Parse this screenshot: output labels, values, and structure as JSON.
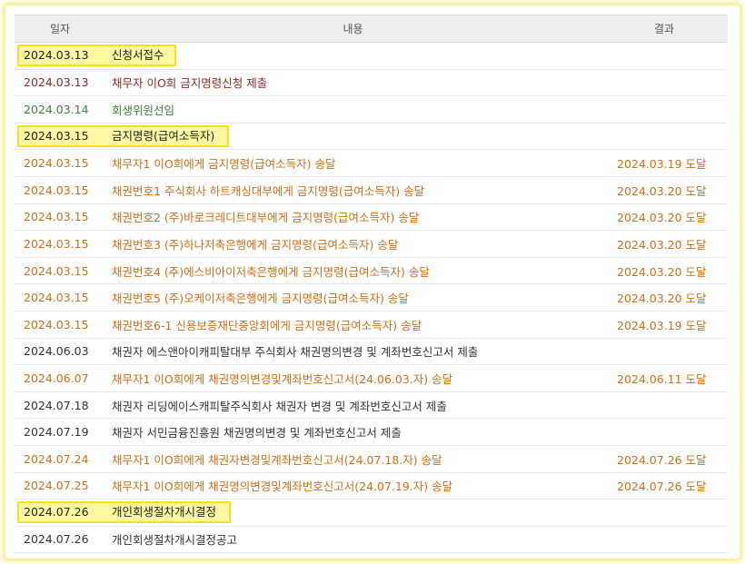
{
  "header": {
    "date": "일자",
    "content": "내용",
    "result": "결과"
  },
  "rows": [
    {
      "date": "2024.03.13",
      "content": "신청서접수",
      "result": ""
    },
    {
      "date": "2024.03.13",
      "content": "채무자 이O희 금지명령신청 제출",
      "result": ""
    },
    {
      "date": "2024.03.14",
      "content": "회생위원선임",
      "result": ""
    },
    {
      "date": "2024.03.15",
      "content": "금지명령(급여소득자)",
      "result": ""
    },
    {
      "date": "2024.03.15",
      "content": "채무자1 이O희에게 금지명령(급여소득자) 송달",
      "result": "2024.03.19 도달"
    },
    {
      "date": "2024.03.15",
      "content": "채권번호1 주식회사 하트캐싱대부에게 금지명령(급여소득자) 송달",
      "result": "2024.03.20 도달"
    },
    {
      "date": "2024.03.15",
      "content": "채권번호2 (주)바로크레디트대부에게 금지명령(급여소득자) 송달",
      "result": "2024.03.20 도달"
    },
    {
      "date": "2024.03.15",
      "content": "채권번호3 (주)하나저축은행에게 금지명령(급여소득자) 송달",
      "result": "2024.03.20 도달"
    },
    {
      "date": "2024.03.15",
      "content": "채권번호4 (주)에스비아이저축은행에게 금지명령(급여소득자) 송달",
      "result": "2024.03.20 도달"
    },
    {
      "date": "2024.03.15",
      "content": "채권번호5 (주)오케이저축은행에게 금지명령(급여소득자) 송달",
      "result": "2024.03.20 도달"
    },
    {
      "date": "2024.03.15",
      "content": "채권번호6-1 신용보증재단중앙회에게 금지명령(급여소득자) 송달",
      "result": "2024.03.19 도달"
    },
    {
      "date": "2024.06.03",
      "content": "채권자 에스앤아이캐피탈대부 주식회사 채권명의변경 및 계좌번호신고서 제출",
      "result": ""
    },
    {
      "date": "2024.06.07",
      "content": "채무자1 이O희에게 채권명의변경및계좌번호신고서(24.06.03.자) 송달",
      "result": "2024.06.11 도달"
    },
    {
      "date": "2024.07.18",
      "content": "채권자 리딩에이스캐피탈주식회사 채권자 변경 및 계좌번호신고서 제출",
      "result": ""
    },
    {
      "date": "2024.07.19",
      "content": "채권자 서민금융진흥원 채권명의변경 및 계좌번호신고서 제출",
      "result": ""
    },
    {
      "date": "2024.07.24",
      "content": "채무자1 이O희에게 채권자변경및계좌번호신고서(24.07.18.자) 송달",
      "result": "2024.07.26 도달"
    },
    {
      "date": "2024.07.25",
      "content": "채무자1 이O희에게 채권명의변경및계좌번호신고서(24.07.19.자) 송달",
      "result": "2024.07.26 도달"
    },
    {
      "date": "2024.07.26",
      "content": "개인회생절차개시결정",
      "result": ""
    },
    {
      "date": "2024.07.26",
      "content": "개인회생절차개시결정공고",
      "result": ""
    }
  ]
}
